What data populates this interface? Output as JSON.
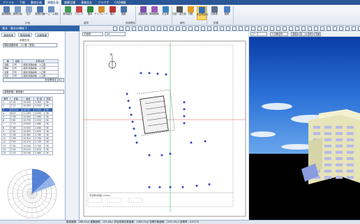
{
  "menu": [
    "ファイル",
    "下絵",
    "敷地計画",
    "建築計画",
    "概算見積",
    "事業収支",
    "ブラウザ",
    "CAD構築"
  ],
  "menu_active_index": 3,
  "ribbon": {
    "buttons": [
      {
        "label": "建物概略",
        "icon": "building-icon",
        "color": "#5a7fb5"
      },
      {
        "label": "建物計画",
        "icon": "floor-plan-icon",
        "color": "#7d9cc7"
      },
      {
        "label": "住戸",
        "icon": "unit-icon",
        "color": "#8fa8d0"
      },
      {
        "label": "配置計画",
        "icon": "layout-icon",
        "color": "#4e79b3"
      },
      {
        "label": "ボリューム検討",
        "icon": "volume-icon",
        "color": "#6c8fc2"
      },
      {
        "label": "敷地設計",
        "icon": "site-icon",
        "color": "#3d9a54"
      },
      {
        "label": "ブロック",
        "icon": "block-icon",
        "color": "#c44"
      },
      {
        "label": "樹木",
        "icon": "tree-icon",
        "color": "#2d8a3e"
      },
      {
        "label": "テンプレート",
        "icon": "template-icon",
        "color": "#d28a2a"
      },
      {
        "label": "集計",
        "icon": "sum-icon",
        "color": "#b33"
      },
      {
        "label": "図面",
        "icon": "drawing-icon",
        "color": "#4571ad"
      },
      {
        "label": "道路斜線",
        "icon": "road-slope-icon",
        "color": "#7a4db0"
      },
      {
        "label": "隣地斜線",
        "icon": "neighbor-slope-icon",
        "color": "#9b59b6"
      },
      {
        "label": "天空率",
        "icon": "sky-factor-icon",
        "color": "#3b82c4"
      },
      {
        "label": "日影・逆日影",
        "icon": "shadow-icon",
        "color": "#555"
      },
      {
        "label": "日照",
        "icon": "sunlight-icon",
        "color": "#e69b1e"
      },
      {
        "label": "天空率計算",
        "icon": "sky-calc-icon",
        "color": "#2f6fb8"
      },
      {
        "label": "計算書",
        "icon": "report-icon",
        "color": "#5d6e87"
      },
      {
        "label": "配置",
        "icon": "place-icon",
        "color": "#4b7fc4"
      }
    ],
    "groups": [
      "計画",
      "建物",
      "斜線関定",
      "解析",
      "配置"
    ]
  },
  "left_header": "基本 · 基本の構成 1",
  "left_panel": {
    "tabs": [
      "道路斜線",
      "隣地斜線",
      "北側斜線"
    ],
    "calc_label": "計算方式",
    "calc_value": "隣接道路斜線 - 入口部（受信）",
    "table1_headers": [
      "種",
      "適用",
      "計算方式"
    ],
    "table1_rows": [
      [
        "道路",
        "OK",
        "緩和/道路斜線 - 入口部"
      ],
      [
        "隣地",
        "OK",
        "緩和/道路斜線 - 入口部"
      ],
      [
        "北側",
        "OK",
        "緩和/道路斜線 - 入口部"
      ],
      [
        "天空",
        "OK",
        "緩和/道路斜線 - 入口部"
      ]
    ],
    "apply_button": "天空率対比 (CC)",
    "select_label": "道路斜線 / 適用値1",
    "table2_headers": [
      "番号",
      "計画",
      "適合",
      "計-適",
      "判定"
    ],
    "table2_rows": [
      [
        "1",
        "7.14",
        "10.502",
        "3.363",
        "OK"
      ],
      [
        "2",
        "7.17",
        "10.493",
        "3.323",
        "OK"
      ],
      [
        "3",
        "13.714",
        "16.767",
        "3.053",
        "OK"
      ],
      [
        "4",
        "8.07",
        "11.163",
        "3.093",
        "OK"
      ],
      [
        "5",
        "7.96",
        "10.944",
        "2.984",
        "OK"
      ],
      [
        "6",
        "7.81",
        "10.735",
        "2.925",
        "OK"
      ],
      [
        "7",
        "7.72",
        "10.600",
        "2.880",
        "OK"
      ],
      [
        "8",
        "7.66",
        "10.500",
        "2.840",
        "OK"
      ],
      [
        "9",
        "7.61",
        "10.420",
        "2.810",
        "OK"
      ],
      [
        "10",
        "7.58",
        "10.360",
        "2.780",
        "OK"
      ],
      [
        "11",
        "7.56",
        "10.310",
        "2.750",
        "OK"
      ],
      [
        "12",
        "7.55",
        "10.270",
        "2.720",
        "OK"
      ],
      [
        "13",
        "7.54",
        "10.240",
        "2.700",
        "OK"
      ],
      [
        "14",
        "7.54",
        "10.210",
        "2.670",
        "OK"
      ],
      [
        "15",
        "7.53",
        "10.190",
        "2.660",
        "OK"
      ]
    ],
    "selected_row": 2
  },
  "drawing": {
    "layer_select": "平面図",
    "scale_select": "1/A",
    "sheet_title": "天空率計算図 (1/500)"
  },
  "view3d": {
    "mode_select": "パース",
    "style_select": "3.鳥瞰全体",
    "buttons": [
      "透過",
      "影",
      "色彩",
      "背景"
    ]
  },
  "status": "敷地面積：286.00㎡ 建築面積：155.60㎡ 許容容積対象面積：1089.00㎡ 容積対象面積：1032.00㎡ 容積率：6.67/75"
}
